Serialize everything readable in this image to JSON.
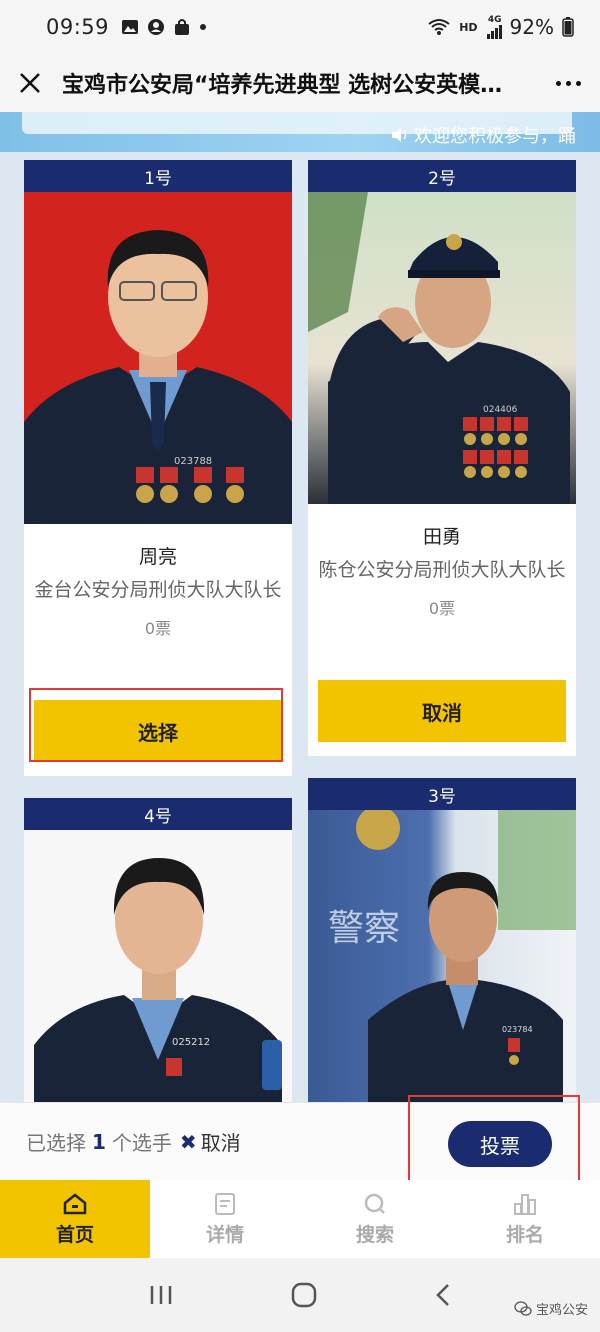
{
  "status_bar": {
    "time": "09:59",
    "network": "HD",
    "signal_label": "4G",
    "battery": "92%",
    "icons": [
      "image-icon",
      "account-icon",
      "bag-icon",
      "dot-icon",
      "wifi-icon",
      "signal-icon",
      "battery-icon"
    ]
  },
  "header": {
    "title": "宝鸡市公安局“培养先进典型 选树公安英模…",
    "close_icon": "close-icon",
    "more_icon": "more-icon"
  },
  "banner": {
    "marquee_text": "欢迎您积极参与，踊"
  },
  "candidates": [
    {
      "number": "1号",
      "name": "周亮",
      "desc": "金台公安分局刑侦大队大队长",
      "votes": "0票",
      "button": "选择",
      "photo_bg": "#d3231f",
      "badge": "023788"
    },
    {
      "number": "2号",
      "name": "田勇",
      "desc": "陈仓公安分局刑侦大队大队长",
      "votes": "0票",
      "button": "取消",
      "photo_bg": "#cfe0c8",
      "badge": "024406"
    },
    {
      "number": "4号",
      "name": "",
      "desc": "",
      "votes": "",
      "button": "",
      "photo_bg": "#f7f7f7",
      "badge": "025212"
    },
    {
      "number": "3号",
      "name": "",
      "desc": "",
      "votes": "",
      "button": "",
      "photo_bg": "#c9d6e6",
      "badge": "023784"
    }
  ],
  "vote_bar": {
    "prefix": "已选择",
    "count": "1",
    "suffix": "个选手",
    "cancel_label": "取消",
    "submit_label": "投票"
  },
  "tabs": [
    {
      "label": "首页",
      "icon": "home-icon",
      "active": true
    },
    {
      "label": "详情",
      "icon": "detail-icon",
      "active": false
    },
    {
      "label": "搜索",
      "icon": "search-icon",
      "active": false
    },
    {
      "label": "排名",
      "icon": "ranking-icon",
      "active": false
    }
  ],
  "watermark": "宝鸡公安",
  "colors": {
    "navy": "#1b2b6f",
    "yellow": "#f2c400",
    "highlight": "#e53935"
  }
}
